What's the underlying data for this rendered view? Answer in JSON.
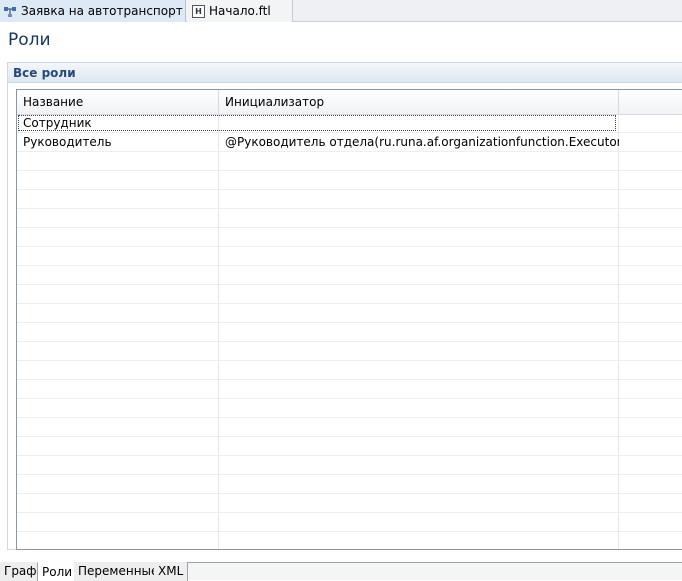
{
  "editor_tabs": [
    {
      "label": "Заявка на автотранспорт",
      "icon": "process-icon",
      "active": true,
      "closable": true
    },
    {
      "label": "Начало.ftl",
      "icon": "ftl-file-icon",
      "active": false
    }
  ],
  "page": {
    "title": "Роли"
  },
  "section": {
    "title": "Все роли"
  },
  "table": {
    "columns": [
      "Название",
      "Инициализатор"
    ],
    "rows": [
      {
        "name": "Сотрудник",
        "initializer": ""
      },
      {
        "name": "Руководитель",
        "initializer": "@Руководитель отдела(ru.runa.af.organizationfunction.ExecutorByCo..."
      }
    ]
  },
  "bottom_tabs": [
    {
      "label": "Граф"
    },
    {
      "label": "Роли",
      "active": true
    },
    {
      "label": "Переменные"
    },
    {
      "label": "XML"
    }
  ],
  "colors": {
    "title": "#17375e",
    "section_header": "#274a78",
    "tab_active": "#dde9f5"
  }
}
